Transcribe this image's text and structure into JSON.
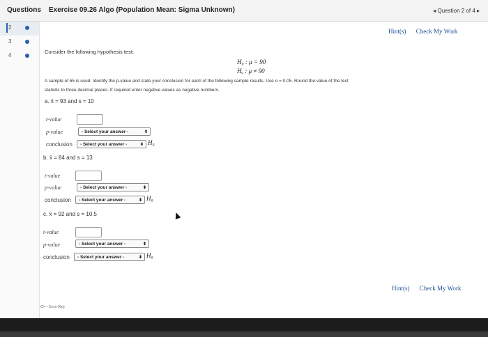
{
  "header": {
    "questions_label": "Questions",
    "title": "Exercise 09.26 Algo (Population Mean: Sigma Unknown)",
    "nav": "◂ Question 2 of 4 ▸"
  },
  "sidebar": {
    "items": [
      {
        "num": "2"
      },
      {
        "num": "3"
      },
      {
        "num": "4"
      }
    ]
  },
  "hints": {
    "hint": "Hint(s)",
    "check": "Check My Work"
  },
  "problem": {
    "intro": "Consider the following hypothesis test:",
    "h0": "H₀ : μ = 90",
    "ha": "Hₐ : μ ≠ 90",
    "description_1": "A sample of 65 is used. Identify the p-value and state your conclusion for each of the following sample results. Use α = 0.05. Round the value of the test",
    "description_2": "statistic to three decimal places. If required enter negative values as negative numbers.",
    "parts": [
      {
        "label": "a.  x̄ = 93 and s = 10",
        "t_label": "t-value",
        "p_label": "p-value",
        "c_label": "conclusion",
        "p_select": "- Select your answer -",
        "c_select": "- Select your answer -",
        "ho": "H₀"
      },
      {
        "label": "b.  x̄ = 84 and s = 13",
        "t_label": "t-value",
        "p_label": "p-value",
        "c_label": "conclusion",
        "p_select": "- Select your answer -",
        "c_select": "- Select your answer -",
        "ho": "H₀"
      },
      {
        "label": "c.  x̄ = 92 and s = 10.5",
        "t_label": "t-value",
        "p_label": "p-value",
        "c_label": "conclusion",
        "p_select": "- Select your answer -",
        "c_select": "- Select your answer -",
        "ho": "H₀"
      }
    ]
  },
  "icon_key": "O— Icon Key",
  "colors": {
    "accent": "#2b5faa",
    "link": "#1f4f96",
    "bottom": "#1c1c1c"
  }
}
